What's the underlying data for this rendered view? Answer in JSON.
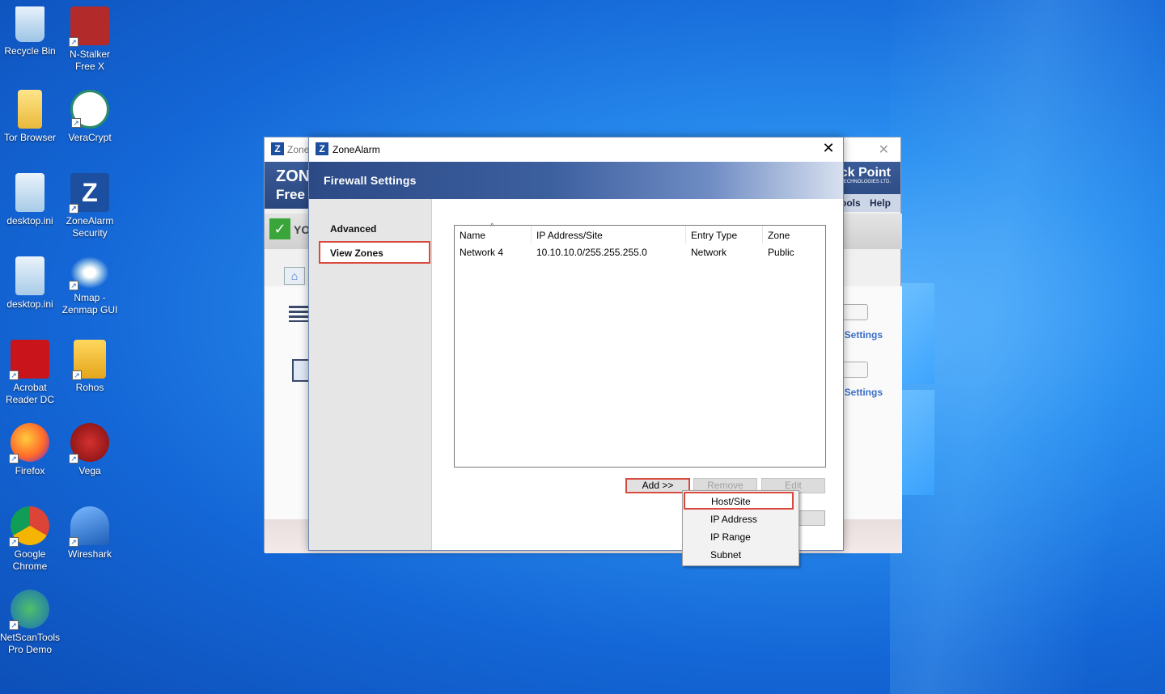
{
  "desktop": {
    "icons": [
      {
        "id": "recycle-bin",
        "label1": "Recycle Bin",
        "label2": ""
      },
      {
        "id": "n-stalker",
        "label1": "N-Stalker",
        "label2": "Free X"
      },
      {
        "id": "tor-browser",
        "label1": "Tor Browser",
        "label2": ""
      },
      {
        "id": "veracrypt",
        "label1": "VeraCrypt",
        "label2": ""
      },
      {
        "id": "desktop-ini-1",
        "label1": "desktop.ini",
        "label2": ""
      },
      {
        "id": "zonealarm",
        "label1": "ZoneAlarm",
        "label2": "Security"
      },
      {
        "id": "desktop-ini-2",
        "label1": "desktop.ini",
        "label2": ""
      },
      {
        "id": "nmap",
        "label1": "Nmap -",
        "label2": "Zenmap GUI"
      },
      {
        "id": "acrobat",
        "label1": "Acrobat",
        "label2": "Reader DC"
      },
      {
        "id": "rohos",
        "label1": "Rohos",
        "label2": ""
      },
      {
        "id": "firefox",
        "label1": "Firefox",
        "label2": ""
      },
      {
        "id": "vega",
        "label1": "Vega",
        "label2": ""
      },
      {
        "id": "chrome",
        "label1": "Google",
        "label2": "Chrome"
      },
      {
        "id": "wireshark",
        "label1": "Wireshark",
        "label2": ""
      },
      {
        "id": "netscantools",
        "label1": "NetScanTools",
        "label2": "Pro Demo"
      }
    ]
  },
  "background_window": {
    "title": "Zone",
    "brand_line1": "ZONI",
    "brand_line2": "Free",
    "checkpoint": "ck Point",
    "checkpoint_sub": "TECHNOLOGIES LTD.",
    "menu_tools": "ools",
    "menu_help": "Help",
    "status_partial": "YO",
    "settings_1": "Settings",
    "settings_2": "Settings"
  },
  "dialog": {
    "title": "ZoneAlarm",
    "banner": "Firewall Settings",
    "nav": {
      "advanced": "Advanced",
      "view_zones": "View Zones"
    },
    "table": {
      "columns": [
        "Name",
        "IP Address/Site",
        "Entry Type",
        "Zone"
      ],
      "rows": [
        [
          "Network 4",
          "10.10.10.0/255.255.255.0",
          "Network",
          "Public"
        ]
      ]
    },
    "buttons": {
      "add": "Add >>",
      "remove": "Remove",
      "edit": "Edit"
    },
    "add_menu": [
      "Host/Site",
      "IP Address",
      "IP Range",
      "Subnet"
    ]
  },
  "colors": {
    "highlight": "#d94a3e",
    "banner": "#2c4a86"
  }
}
